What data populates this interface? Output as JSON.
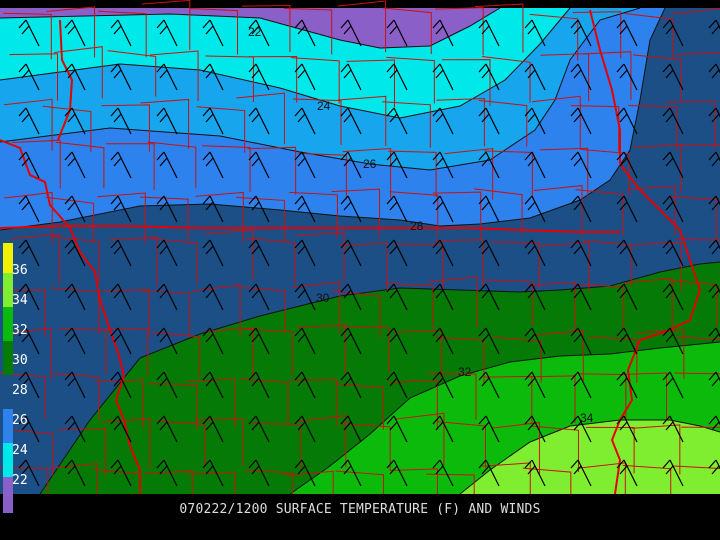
{
  "caption": "070222/1200 SURFACE TEMPERATURE (F) AND WINDS",
  "units": "F",
  "colors": {
    "t22": "#8a5fc8",
    "t24": "#00e8ea",
    "t26": "#17a5ee",
    "t28": "#2d82ee",
    "t30": "#1c4f86",
    "t32": "#067a06",
    "t34": "#0cba0c",
    "t36": "#80ee30",
    "t36_legend": "#f0f000",
    "county_lines": "#cc1010",
    "state_lines": "#e60000",
    "wind_barbs": "#000000",
    "contour_lines": "#111111"
  },
  "contours": [
    {
      "label": "22",
      "value": 22
    },
    {
      "label": "24",
      "value": 24
    },
    {
      "label": "26",
      "value": 26
    },
    {
      "label": "28",
      "value": 28
    },
    {
      "label": "30",
      "value": 30
    },
    {
      "label": "32",
      "value": 32
    },
    {
      "label": "34",
      "value": 34
    }
  ],
  "legend": {
    "labels": [
      "36",
      "34",
      "32",
      "30",
      "28",
      "26",
      "24",
      "22"
    ]
  }
}
